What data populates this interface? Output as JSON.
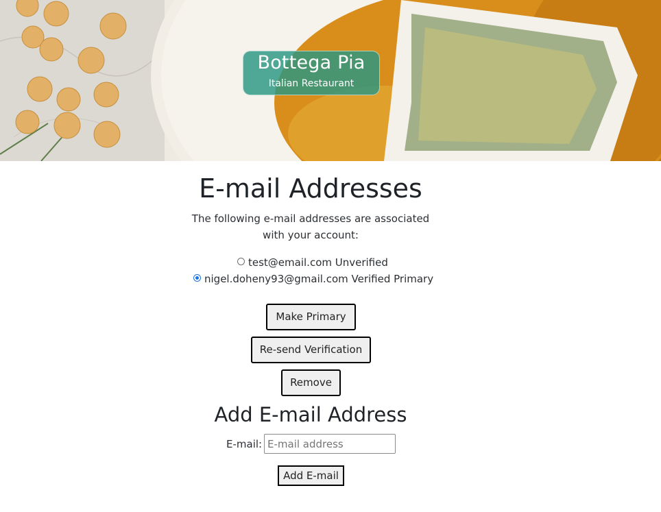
{
  "hero": {
    "brand_title": "Bottega Pia",
    "brand_subtitle": "Italian Restaurant"
  },
  "emails": {
    "heading": "E-mail Addresses",
    "intro": "The following e-mail addresses are associated with your account:",
    "items": [
      {
        "label": "test@email.com Unverified",
        "selected": false
      },
      {
        "label": "nigel.doheny93@gmail.com Verified Primary",
        "selected": true
      }
    ],
    "make_primary_label": "Make Primary",
    "resend_label": "Re-send Verification",
    "remove_label": "Remove"
  },
  "add_email": {
    "heading": "Add E-mail Address",
    "field_label": "E-mail:",
    "placeholder": "E-mail address",
    "value": "",
    "submit_label": "Add E-mail"
  },
  "colors": {
    "brand_badge": "#2a9682",
    "radio_accent": "#1a73e8",
    "text": "#212529"
  }
}
